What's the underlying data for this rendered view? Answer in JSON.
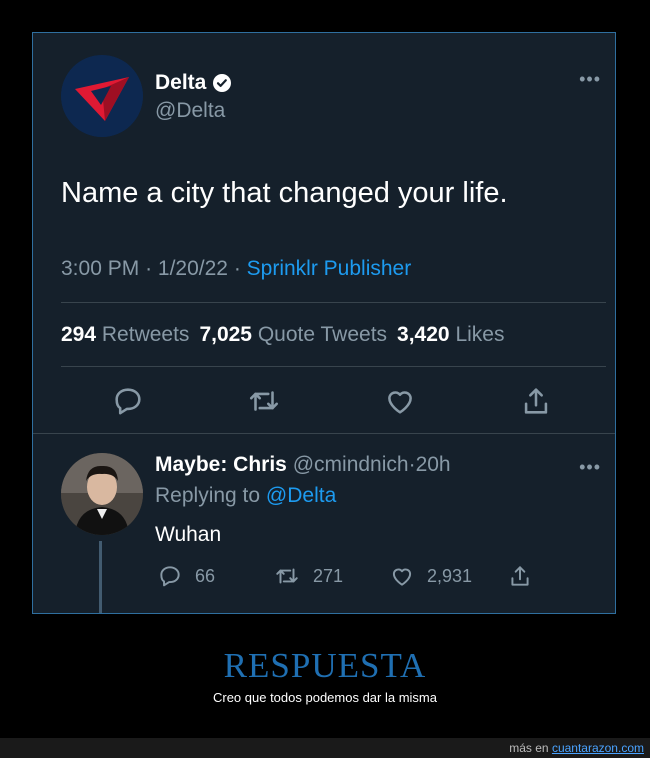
{
  "tweet": {
    "display_name": "Delta",
    "handle": "@Delta",
    "verified_icon": "verified-badge-icon",
    "more_icon": "more-options-icon",
    "text": "Name a city that changed your life.",
    "time": "3:00 PM",
    "date": "1/20/22",
    "source": "Sprinklr Publisher",
    "retweets_count": "294",
    "retweets_label": "Retweets",
    "quotes_count": "7,025",
    "quotes_label": "Quote Tweets",
    "likes_count": "3,420",
    "likes_label": "Likes"
  },
  "reply": {
    "display_name": "Maybe: Chris",
    "handle": "@cmindnich",
    "time": "20h",
    "replying_prefix": "Replying to",
    "replying_handle": "@Delta",
    "text": "Wuhan",
    "replies": "66",
    "retweets": "271",
    "likes": "2,931"
  },
  "caption": {
    "title": "RESPUESTA",
    "subtitle": "Creo que todos podemos dar la misma"
  },
  "footer": {
    "prefix": "más en",
    "link": "cuantarazon.com"
  },
  "colors": {
    "card_bg": "#15202b",
    "accent": "#1d9bf0",
    "delta_red": "#c8102e",
    "caption_blue": "#1f6fb2"
  }
}
